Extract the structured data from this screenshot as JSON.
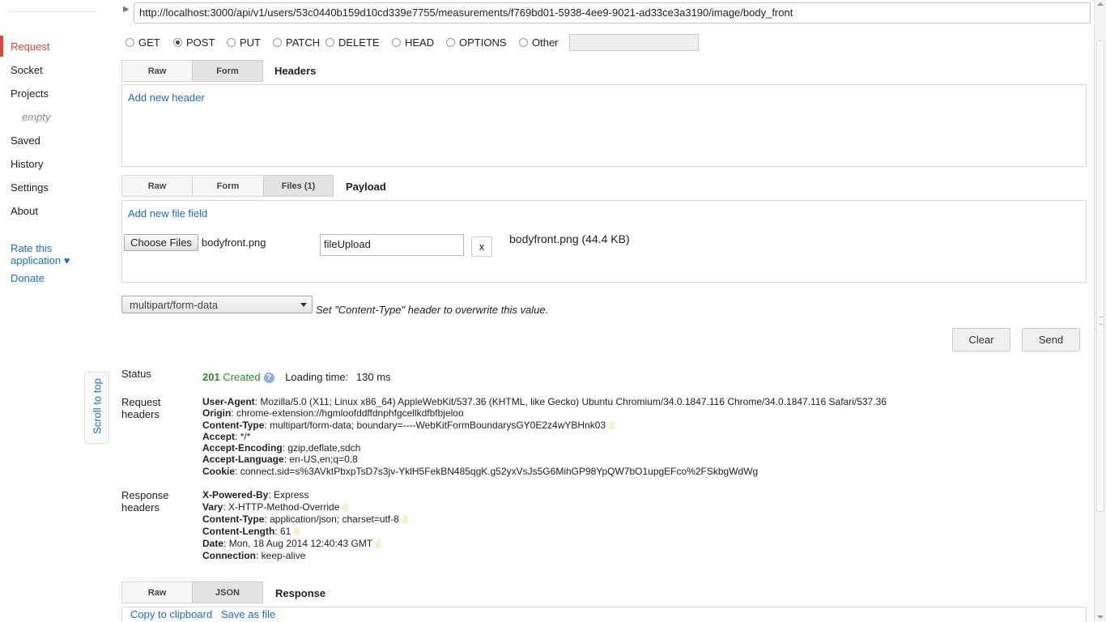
{
  "sidebar": {
    "items": [
      {
        "label": "Request"
      },
      {
        "label": "Socket"
      },
      {
        "label": "Projects"
      },
      {
        "label": "empty"
      },
      {
        "label": "Saved"
      },
      {
        "label": "History"
      },
      {
        "label": "Settings"
      },
      {
        "label": "About"
      }
    ],
    "rate_line1": "Rate this",
    "rate_line2": "application ♥",
    "donate": "Donate",
    "scroll_to_top": "Scroll to top"
  },
  "request": {
    "url": "http://localhost:3000/api/v1/users/53c0440b159d10cd339e7755/measurements/f769bd01-5938-4ee9-9021-ad33ce3a3190/image/body_front",
    "methods": [
      "GET",
      "POST",
      "PUT",
      "PATCH",
      "DELETE",
      "HEAD",
      "OPTIONS",
      "Other"
    ],
    "selected_method": "POST"
  },
  "headers_section": {
    "tabs": [
      "Raw",
      "Form"
    ],
    "active_tab": "Form",
    "title": "Headers",
    "add_link": "Add new header"
  },
  "payload_section": {
    "tabs": [
      "Raw",
      "Form",
      "Files (1)"
    ],
    "active_tab": "Files (1)",
    "title": "Payload",
    "add_link": "Add new file field",
    "choose_button": "Choose Files",
    "chosen_file": "bodyfront.png",
    "field_name": "fileUpload",
    "remove_button": "x",
    "file_info": "bodyfront.png (44.4 KB)"
  },
  "content_type": {
    "selected": "multipart/form-data",
    "hint": "Set \"Content-Type\" header to overwrite this value."
  },
  "actions": {
    "clear": "Clear",
    "send": "Send"
  },
  "status": {
    "label": "Status",
    "code": "201",
    "text": "Created",
    "loading_label": "Loading time:",
    "loading_value": "130 ms"
  },
  "request_headers": {
    "label_line1": "Request",
    "label_line2": "headers",
    "items": [
      {
        "key": "User-Agent",
        "value": "Mozilla/5.0 (X11; Linux x86_64) AppleWebKit/537.36 (KHTML, like Gecko) Ubuntu Chromium/34.0.1847.116 Chrome/34.0.1847.116 Safari/537.36"
      },
      {
        "key": "Origin",
        "value": "chrome-extension://hgmloofddffdnphfgcellkdfbfbjeloo"
      },
      {
        "key": "Content-Type",
        "value": "multipart/form-data; boundary=----WebKitFormBoundarysGY0E2z4wYBHnk03"
      },
      {
        "key": "Accept",
        "value": "*/*"
      },
      {
        "key": "Accept-Encoding",
        "value": "gzip,deflate,sdch"
      },
      {
        "key": "Accept-Language",
        "value": "en-US,en;q=0.8"
      },
      {
        "key": "Cookie",
        "value": "connect.sid=s%3AVktPbxpTsD7s3jv-YklH5FekBN485qgK.g52yxVsJs5G6MihGP98YpQW7bO1upgEFco%2FSkbgWdWg"
      }
    ]
  },
  "response_headers": {
    "label_line1": "Response",
    "label_line2": "headers",
    "items": [
      {
        "key": "X-Powered-By",
        "value": "Express"
      },
      {
        "key": "Vary",
        "value": "X-HTTP-Method-Override"
      },
      {
        "key": "Content-Type",
        "value": "application/json; charset=utf-8"
      },
      {
        "key": "Content-Length",
        "value": "61"
      },
      {
        "key": "Date",
        "value": "Mon, 18 Aug 2014 12:40:43 GMT"
      },
      {
        "key": "Connection",
        "value": "keep-alive"
      }
    ]
  },
  "response_section": {
    "tabs": [
      "Raw",
      "JSON"
    ],
    "active_tab": "JSON",
    "title": "Response",
    "copy_link": "Copy to clipboard",
    "save_link": "Save as file"
  },
  "colors": {
    "accent": "#d9443b",
    "link": "#1a6fbf",
    "success": "#2e8b2e"
  }
}
